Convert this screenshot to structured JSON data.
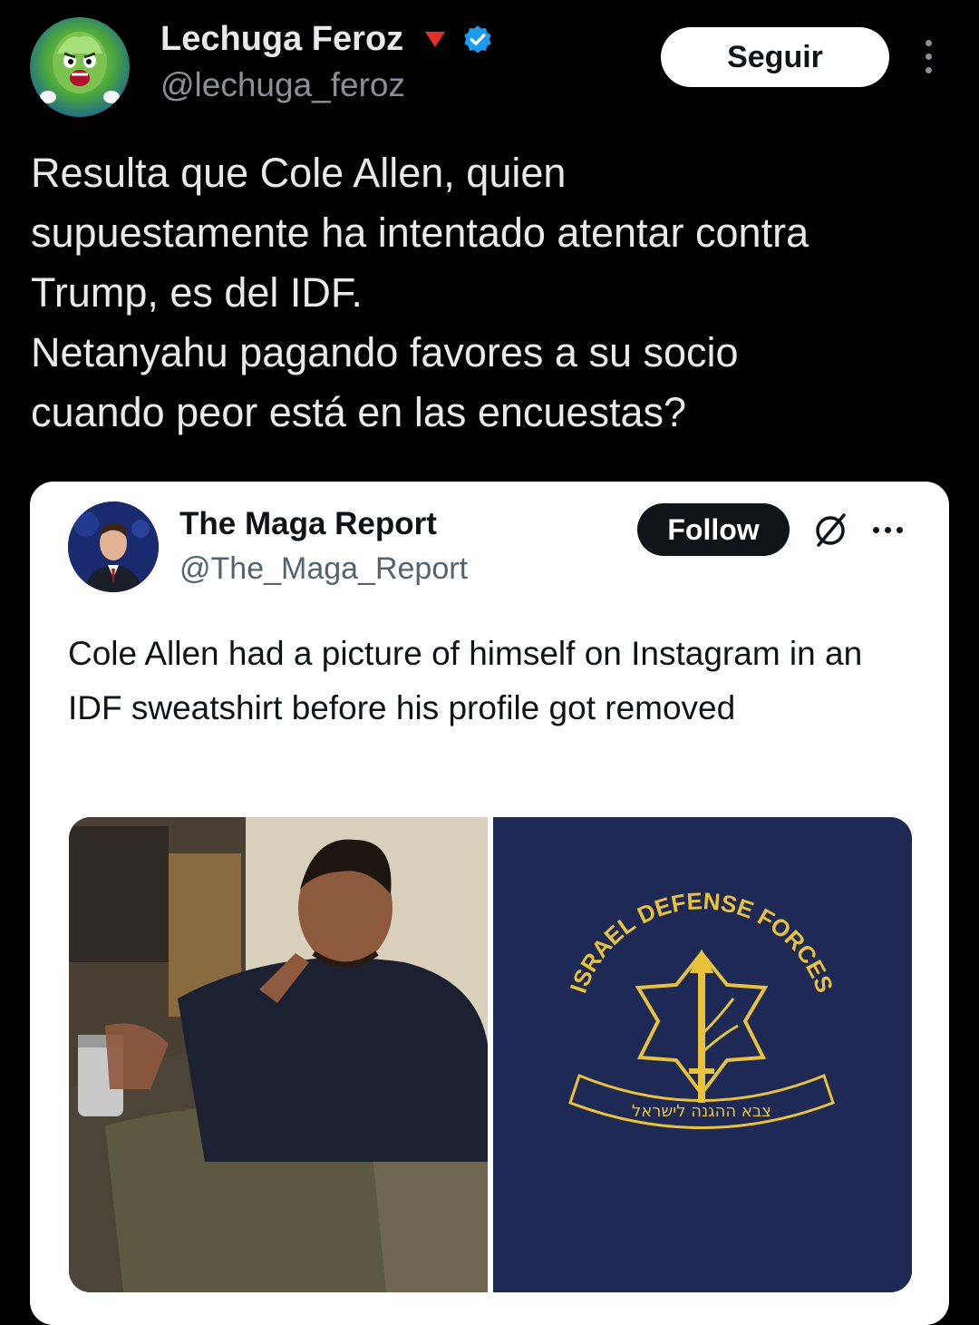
{
  "tweet": {
    "author": {
      "name": "Lechuga Feroz",
      "handle": "@lechuga_feroz",
      "avatar_icon": "lettuce-avatar",
      "verified": true
    },
    "follow_label": "Seguir",
    "text": "Resulta que Cole Allen, quien\nsupuestamente ha intentado atentar contra\nTrump, es del IDF.\nNetanyahu pagando favores a su socio\ncuando peor está en las encuestas?"
  },
  "quoted": {
    "author": {
      "name": "The Maga Report",
      "handle": "@The_Maga_Report",
      "avatar_icon": "person-avatar"
    },
    "follow_label": "Follow",
    "text": "Cole Allen had a picture of himself on Instagram in an IDF sweatshirt before his profile got removed",
    "media": [
      {
        "kind": "photo",
        "icon": "man-in-chair-photo"
      },
      {
        "kind": "photo",
        "icon": "idf-emblem-photo",
        "emblem_text": "ISRAEL DEFENSE FORCES",
        "hebrew_text": "צבא ההגנה לישראל"
      }
    ]
  },
  "colors": {
    "background": "#000000",
    "text_primary": "#e7e9ea",
    "text_secondary": "#8b9096",
    "verified_blue": "#1d9bf0",
    "card_bg": "#ffffff",
    "emblem_gold": "#e8c23a",
    "sweatshirt_navy": "#1e2a55"
  }
}
